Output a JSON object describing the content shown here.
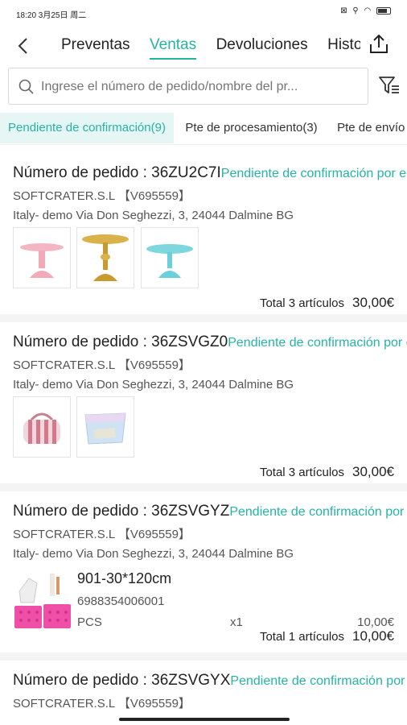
{
  "status_bar": {
    "time": "18:20 3月25日 周二",
    "icons": "⊠ ⚲ ◠"
  },
  "nav": {
    "tabs": [
      {
        "label": "Preventas"
      },
      {
        "label": "Ventas"
      },
      {
        "label": "Devoluciones"
      },
      {
        "label": "Historial"
      }
    ],
    "active_tab": "Ventas"
  },
  "search": {
    "placeholder": "Ingrese el número de pedido/nombre del pr..."
  },
  "status_tabs": [
    {
      "label": "Pendiente de confirmación(9)"
    },
    {
      "label": "Pte de procesamiento(3)"
    },
    {
      "label": "Pte de envío"
    }
  ],
  "orders": [
    {
      "prefix": "Número de pedido : ",
      "number": "36ZU2C7I",
      "status": "Pendiente de confirmación por el cliente",
      "company": "SOFTCRATER.S.L 【V695559】",
      "address": "Italy- demo Via Don Seghezzi, 3, 24044 Dalmine BG",
      "total_label": "Total 3 artículos",
      "total_amount": "30,00€"
    },
    {
      "prefix": "Número de pedido : ",
      "number": "36ZSVGZ0",
      "status": "Pendiente de confirmación por el cliente",
      "company": "SOFTCRATER.S.L 【V695559】",
      "address": "Italy- demo Via Don Seghezzi, 3, 24044 Dalmine BG",
      "total_label": "Total 3 artículos",
      "total_amount": "30,00€"
    },
    {
      "prefix": "Número de pedido : ",
      "number": "36ZSVGYZ",
      "status": "Pendiente de confirmación por el cliente",
      "company": "SOFTCRATER.S.L 【V695559】",
      "address": "Italy- demo Via Don Seghezzi, 3, 24044 Dalmine BG",
      "item": {
        "name": "901-30*120cm",
        "code": "6988354006001",
        "unit": "PCS",
        "qty": "x1",
        "price": "10,00€"
      },
      "total_label": "Total 1 artículos",
      "total_amount": "10,00€"
    },
    {
      "prefix": "Número de pedido : ",
      "number": "36ZSVGYX",
      "status": "Pendiente de confirmación por el cliente",
      "company": "SOFTCRATER.S.L 【V695559】"
    }
  ],
  "colors": {
    "accent": "#26b3a5",
    "accent_bg": "#e6f6f4"
  }
}
